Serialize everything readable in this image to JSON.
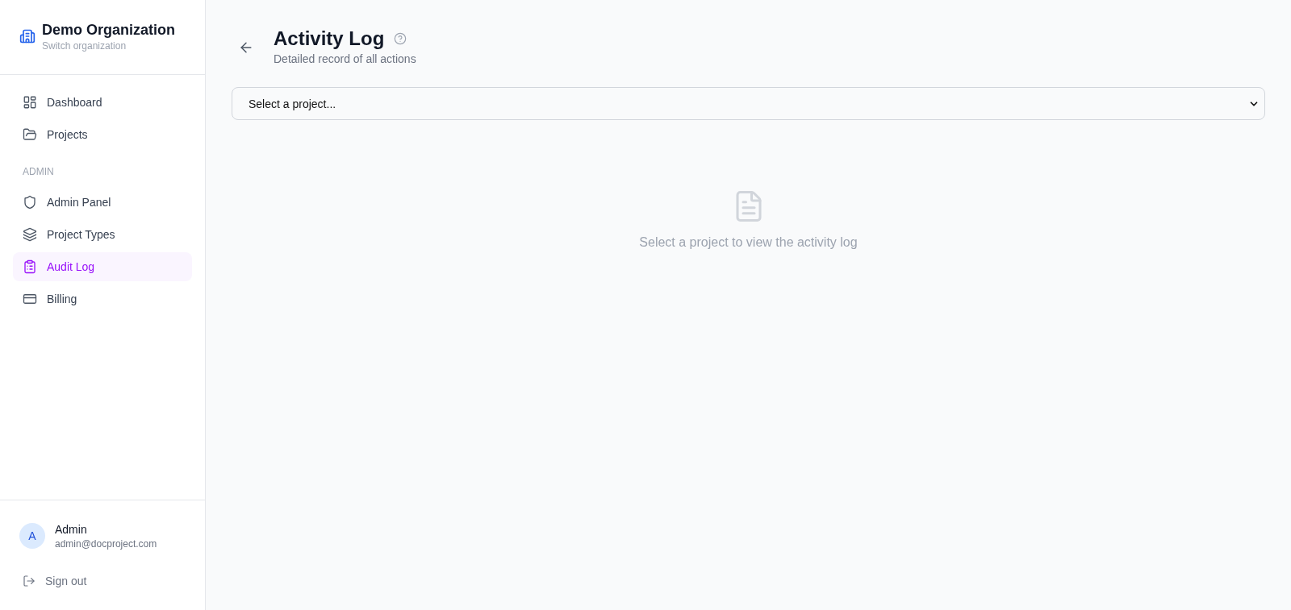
{
  "sidebar": {
    "organization": {
      "name": "Demo Organization",
      "subtitle": "Switch organization"
    },
    "nav_sections": [
      {
        "items": [
          {
            "label": "Dashboard",
            "selected": false
          },
          {
            "label": "Projects",
            "selected": false
          }
        ]
      },
      {
        "heading": "ADMIN",
        "items": [
          {
            "label": "Admin Panel",
            "selected": false
          },
          {
            "label": "Project Types",
            "selected": false
          },
          {
            "label": "Audit Log",
            "selected": true
          },
          {
            "label": "Billing",
            "selected": false
          }
        ]
      }
    ],
    "user": {
      "avatar_initial": "A",
      "name": "Admin",
      "email": "admin@docproject.com"
    },
    "sign_out": "Sign out"
  },
  "main": {
    "title": "Activity Log",
    "subtitle": "Detailed record of all actions",
    "project_select": {
      "value": "Select a project..."
    },
    "empty_state": {
      "message": "Select a project to view the activity log"
    }
  }
}
